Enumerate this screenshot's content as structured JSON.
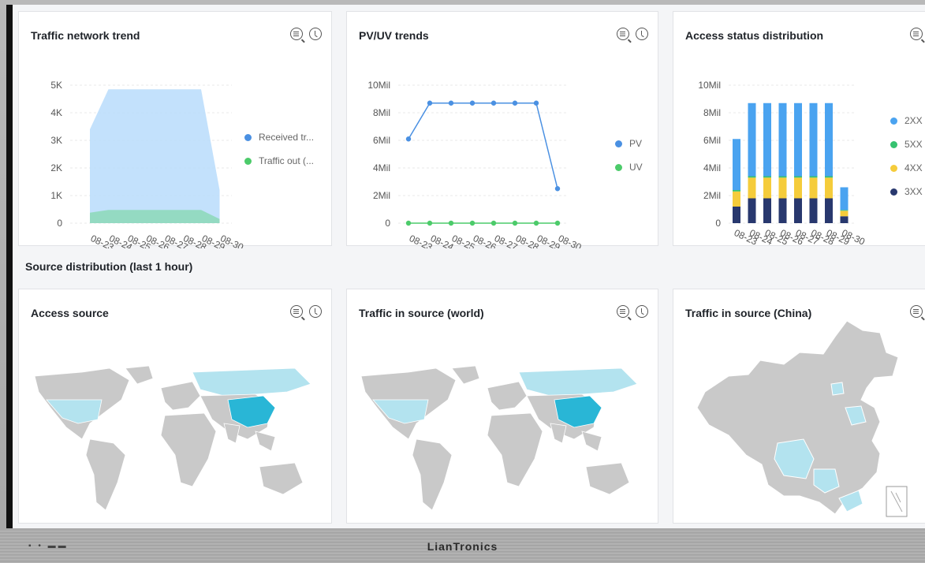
{
  "cards": {
    "traffic": {
      "title": "Traffic network trend"
    },
    "pvuv": {
      "title": "PV/UV trends"
    },
    "status": {
      "title": "Access status distribution"
    },
    "access": {
      "title": "Access source"
    },
    "world": {
      "title": "Traffic in source (world)"
    },
    "china": {
      "title": "Traffic in source (China)"
    }
  },
  "section": {
    "title": "Source distribution (last 1 hour)"
  },
  "bezel": {
    "brand": "LianTronics",
    "marks": "▪ • ▬▬"
  },
  "colors": {
    "received": "#b9dcfb",
    "traffic_out": "#8fd9bb",
    "pv": "#4a90e2",
    "uv": "#4ccb6a",
    "c2xx": "#4aa3f0",
    "c5xx": "#36c270",
    "c4xx": "#f5cc3b",
    "c3xx": "#28386e",
    "map_land": "#c9c9c9",
    "map_light": "#b3e3ef",
    "map_strong": "#29b6d6"
  },
  "chart_data": [
    {
      "type": "area",
      "x": [
        "08-23",
        "08-24",
        "08-25",
        "08-26",
        "08-27",
        "08-28",
        "08-29",
        "08-30"
      ],
      "ylim": [
        0,
        5000
      ],
      "yticks": [
        "0",
        "1K",
        "2K",
        "3K",
        "4K",
        "5K"
      ],
      "series": [
        {
          "name": "Received tr...",
          "values": [
            3400,
            4850,
            4850,
            4850,
            4850,
            4850,
            4850,
            1200
          ]
        },
        {
          "name": "Traffic out (...",
          "values": [
            380,
            480,
            480,
            480,
            480,
            480,
            480,
            150
          ]
        }
      ]
    },
    {
      "type": "line",
      "x": [
        "08-23",
        "08-24",
        "08-25",
        "08-26",
        "08-27",
        "08-28",
        "08-29",
        "08-30"
      ],
      "ylim": [
        0,
        10
      ],
      "yticks": [
        "0",
        "2Mil",
        "4Mil",
        "6Mil",
        "8Mil",
        "10Mil"
      ],
      "series": [
        {
          "name": "PV",
          "values": [
            6.1,
            8.7,
            8.7,
            8.7,
            8.7,
            8.7,
            8.7,
            2.5
          ]
        },
        {
          "name": "UV",
          "values": [
            0,
            0,
            0,
            0,
            0,
            0,
            0,
            0
          ]
        }
      ]
    },
    {
      "type": "bar",
      "x": [
        "08-23",
        "08-24",
        "08-25",
        "08-26",
        "08-27",
        "08-28",
        "08-29",
        "08-30"
      ],
      "ylim": [
        0,
        10
      ],
      "yticks": [
        "0",
        "2Mil",
        "4Mil",
        "6Mil",
        "8Mil",
        "10Mil"
      ],
      "stacked": true,
      "series": [
        {
          "name": "3XX",
          "values": [
            1.2,
            1.8,
            1.8,
            1.8,
            1.8,
            1.8,
            1.8,
            0.5
          ]
        },
        {
          "name": "4XX",
          "values": [
            1.1,
            1.5,
            1.5,
            1.5,
            1.5,
            1.5,
            1.5,
            0.4
          ]
        },
        {
          "name": "5XX",
          "values": [
            0.1,
            0.1,
            0.1,
            0.1,
            0.1,
            0.1,
            0.1,
            0.05
          ]
        },
        {
          "name": "2XX",
          "values": [
            3.7,
            5.3,
            5.3,
            5.3,
            5.3,
            5.3,
            5.3,
            1.65
          ]
        }
      ],
      "legend_order": [
        "2XX",
        "5XX",
        "4XX",
        "3XX"
      ]
    }
  ]
}
